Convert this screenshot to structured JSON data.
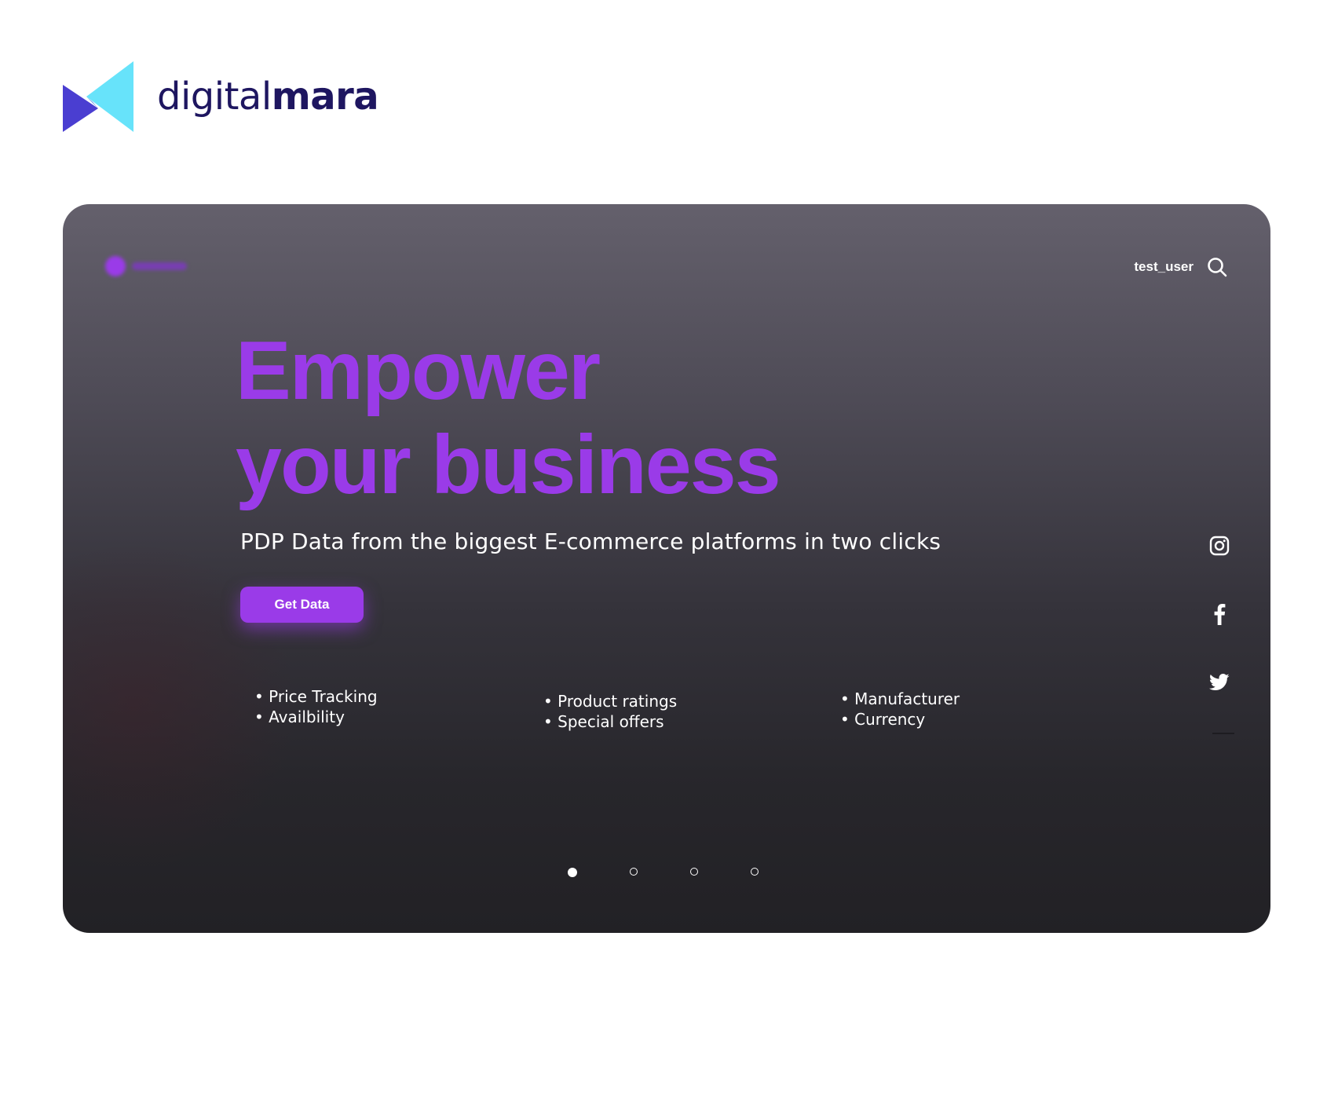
{
  "brand": {
    "name_light": "digital",
    "name_bold": "mara",
    "colors": {
      "wordmark": "#1e1660",
      "mark_cyan": "#67e3fa",
      "mark_indigo": "#4a3ed1"
    }
  },
  "screen": {
    "header": {
      "username": "test_user",
      "search_icon": "search-icon"
    },
    "hero": {
      "title_line1": "Empower",
      "title_line2": "your business",
      "subtitle": "PDP Data from the biggest E-commerce platforms in two clicks",
      "cta_label": "Get Data",
      "accent_color": "#9a3be8"
    },
    "features": [
      [
        "Price Tracking",
        "Availbility"
      ],
      [
        "Product ratings",
        "Special offers"
      ],
      [
        "Manufacturer",
        "Currency"
      ]
    ],
    "socials": [
      {
        "icon": "instagram-icon"
      },
      {
        "icon": "facebook-icon"
      },
      {
        "icon": "twitter-icon"
      }
    ],
    "pagination": {
      "total": 4,
      "active_index": 0
    }
  }
}
